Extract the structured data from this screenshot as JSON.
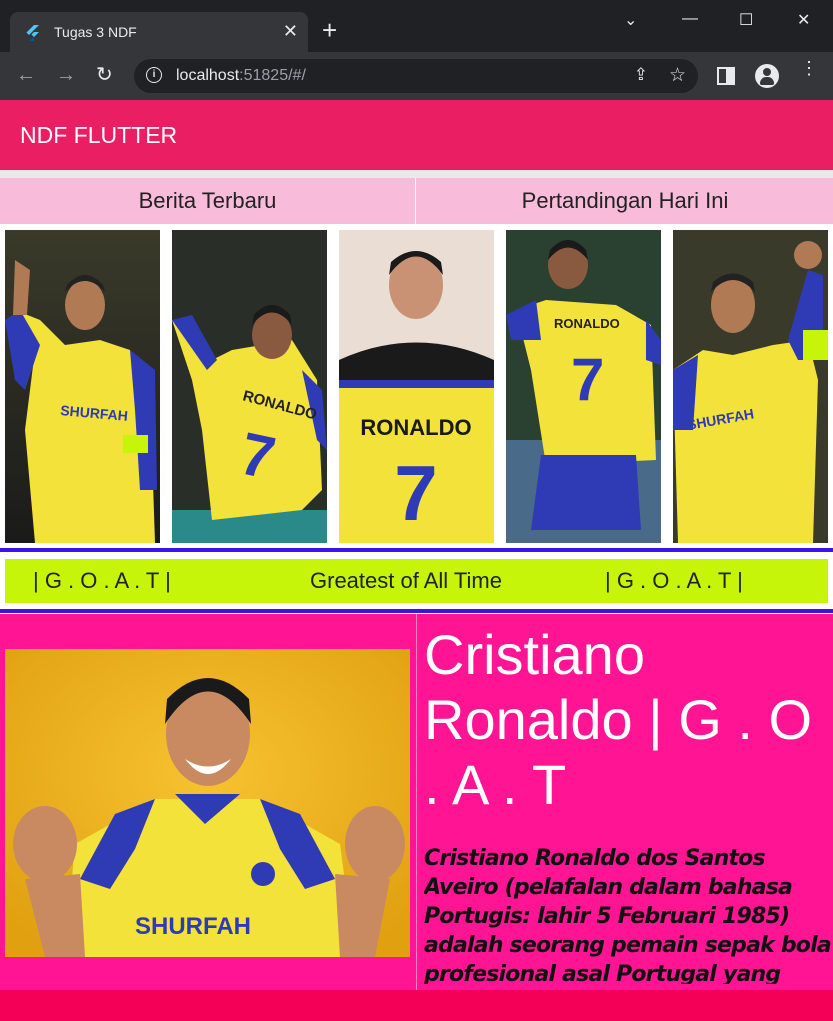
{
  "browser": {
    "tab_title": "Tugas 3 NDF",
    "url_host": "localhost",
    "url_rest": ":51825/#/"
  },
  "app": {
    "title": "NDF FLUTTER",
    "colors": {
      "appbar": "#e91e63",
      "tabs": "#f8bbd9",
      "goat_bar": "#c6f50a",
      "profile": "#ff1493",
      "divider": "#3d14e8",
      "footer": "#f50057"
    }
  },
  "tabs": [
    {
      "label": "Berita Terbaru"
    },
    {
      "label": "Pertandingan Hari Ini"
    }
  ],
  "gallery": [
    {
      "jersey_text": "",
      "number": ""
    },
    {
      "jersey_text": "RONALDO",
      "number": "7"
    },
    {
      "jersey_text": "RONALDO",
      "number": "7"
    },
    {
      "jersey_text": "RONALDO",
      "number": "7"
    },
    {
      "jersey_text": "SHURFAH",
      "number": ""
    }
  ],
  "banner": {
    "left": "| G . O . A . T |",
    "center": "Greatest of All Time",
    "right": "| G . O . A . T |"
  },
  "profile": {
    "name": "Cristiano Ronaldo   | G . O . A . T",
    "jersey_sponsor": "SHURFAH",
    "bio": "Cristiano Ronaldo dos Santos Aveiro (pelafalan dalam bahasa Portugis: lahir 5 Februari 1985) adalah seorang pemain sepak bola profesional asal Portugal yang"
  }
}
